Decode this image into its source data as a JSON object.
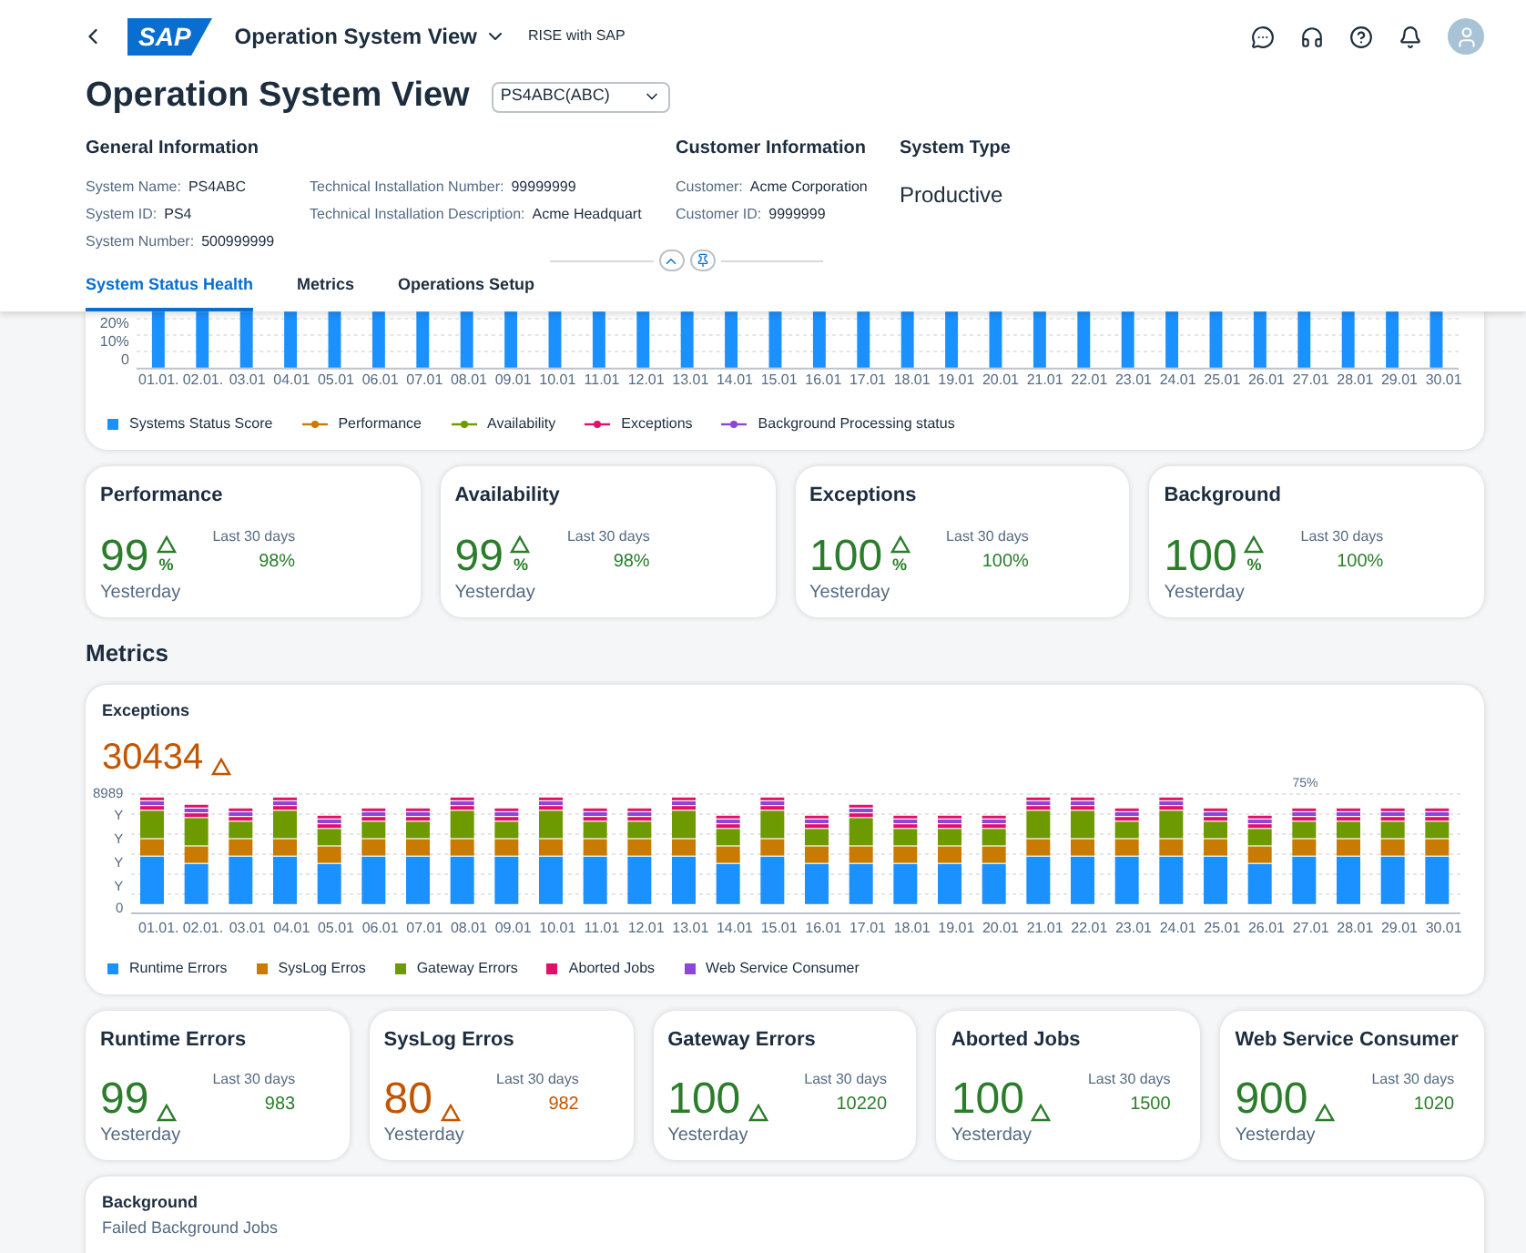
{
  "shell": {
    "logo": "SAP",
    "title": "Operation System View",
    "subtitle": "RISE with SAP"
  },
  "page": {
    "title": "Operation System View",
    "system_select": "PS4ABC(ABC)"
  },
  "general_information": {
    "heading": "General Information",
    "columns": [
      [
        {
          "label": "System Name:",
          "value": "PS4ABC"
        },
        {
          "label": "System ID:",
          "value": "PS4"
        },
        {
          "label": "System Number:",
          "value": "500999999"
        }
      ],
      [
        {
          "label": "Technical Installation Number:",
          "value": "99999999"
        },
        {
          "label": "Technical Installation Description:",
          "value": "Acme Headquart"
        }
      ]
    ]
  },
  "customer_information": {
    "heading": "Customer Information",
    "fields": [
      {
        "label": "Customer:",
        "value": "Acme Corporation"
      },
      {
        "label": "Customer ID:",
        "value": "9999999"
      }
    ]
  },
  "system_type": {
    "heading": "System Type",
    "value": "Productive"
  },
  "tabs": [
    {
      "label": "System Status Health",
      "selected": true
    },
    {
      "label": "Metrics",
      "selected": false
    },
    {
      "label": "Operations Setup",
      "selected": false
    }
  ],
  "status_chart": {
    "y_labels": [
      "20%",
      "10%",
      "0"
    ],
    "x_labels": [
      "01.01.",
      "02.01.",
      "03.01",
      "04.01",
      "05.01",
      "06.01",
      "07.01",
      "08.01",
      "09.01",
      "10.01",
      "11.01",
      "12.01",
      "13.01",
      "14.01",
      "15.01",
      "16.01",
      "17.01",
      "18.01",
      "19.01",
      "20.01",
      "21.01",
      "22.01",
      "23.01",
      "24.01",
      "25.01",
      "26.01",
      "27.01",
      "28.01",
      "29.01",
      "30.01"
    ],
    "legend": [
      {
        "label": "Systems Status Score",
        "kind": "square",
        "color": "#1b90ff"
      },
      {
        "label": "Performance",
        "kind": "line",
        "color": "#c87b00"
      },
      {
        "label": "Availability",
        "kind": "line",
        "color": "#6c9a00"
      },
      {
        "label": "Exceptions",
        "kind": "line",
        "color": "#e3106a"
      },
      {
        "label": "Background Processing status",
        "kind": "line",
        "color": "#8b47d7"
      }
    ]
  },
  "health_kpis": [
    {
      "title": "Performance",
      "value": "99",
      "unit": "%",
      "color": "#2b7d2b",
      "period": "Last 30 days",
      "comparison": "98%",
      "caption": "Yesterday"
    },
    {
      "title": "Availability",
      "value": "99",
      "unit": "%",
      "color": "#2b7d2b",
      "period": "Last 30 days",
      "comparison": "98%",
      "caption": "Yesterday"
    },
    {
      "title": "Exceptions",
      "value": "100",
      "unit": "%",
      "color": "#2b7d2b",
      "period": "Last 30 days",
      "comparison": "100%",
      "caption": "Yesterday"
    },
    {
      "title": "Background",
      "value": "100",
      "unit": "%",
      "color": "#2b7d2b",
      "period": "Last 30 days",
      "comparison": "100%",
      "caption": "Yesterday"
    }
  ],
  "metrics_heading": "Metrics",
  "exceptions_card": {
    "title": "Exceptions",
    "value": "30434",
    "color": "#c35500",
    "y_labels": [
      "8989",
      "Y",
      "Y",
      "Y",
      "Y",
      "0"
    ],
    "annotation": "75%",
    "x_labels": [
      "01.01.",
      "02.01.",
      "03.01",
      "04.01",
      "05.01",
      "06.01",
      "07.01",
      "08.01",
      "09.01",
      "10.01",
      "11.01",
      "12.01",
      "13.01",
      "14.01",
      "15.01",
      "16.01",
      "17.01",
      "18.01",
      "19.01",
      "20.01",
      "21.01",
      "22.01",
      "23.01",
      "24.01",
      "25.01",
      "26.01",
      "27.01",
      "28.01",
      "29.01",
      "30.01"
    ],
    "legend": [
      {
        "label": "Runtime Errors",
        "color": "#1b90ff"
      },
      {
        "label": "SysLog Erros",
        "color": "#c87b00"
      },
      {
        "label": "Gateway Errors",
        "color": "#6c9a00"
      },
      {
        "label": "Aborted Jobs",
        "color": "#e3106a"
      },
      {
        "label": "Web Service Consumer",
        "color": "#8b47d7"
      }
    ]
  },
  "exception_kpis": [
    {
      "title": "Runtime Errors",
      "value": "99",
      "color": "#2b7d2b",
      "period": "Last 30 days",
      "comparison": "983",
      "caption": "Yesterday"
    },
    {
      "title": "SysLog Erros",
      "value": "80",
      "color": "#c35500",
      "period": "Last 30 days",
      "comparison": "982",
      "caption": "Yesterday"
    },
    {
      "title": "Gateway Errors",
      "value": "100",
      "color": "#2b7d2b",
      "period": "Last 30 days",
      "comparison": "10220",
      "caption": "Yesterday"
    },
    {
      "title": "Aborted Jobs",
      "value": "100",
      "color": "#2b7d2b",
      "period": "Last 30 days",
      "comparison": "1500",
      "caption": "Yesterday"
    },
    {
      "title": "Web Service Consumer",
      "value": "900",
      "color": "#2b7d2b",
      "period": "Last 30 days",
      "comparison": "1020",
      "caption": "Yesterday"
    }
  ],
  "background_card": {
    "title": "Background",
    "subtitle": "Failed Background Jobs"
  }
}
